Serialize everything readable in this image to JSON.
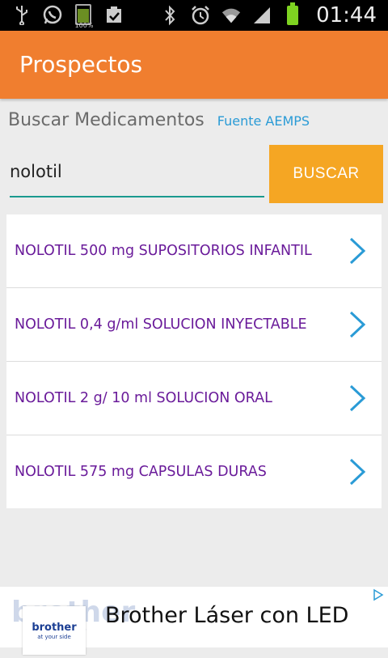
{
  "status_bar": {
    "time": "01:44",
    "small_battery_label": "100%",
    "icons": [
      "usb-icon",
      "whatsapp-icon",
      "battery-full-icon",
      "clipboard-check-icon",
      "bluetooth-icon",
      "alarm-icon",
      "wifi-icon",
      "signal-icon",
      "battery-charging-icon"
    ]
  },
  "app_bar": {
    "title": "Prospectos"
  },
  "search": {
    "heading": "Buscar Medicamentos",
    "source_link": "Fuente AEMPS",
    "query": "nolotil",
    "button_label": "BUSCAR"
  },
  "results": [
    {
      "name": "NOLOTIL  500 mg SUPOSITORIOS INFANTIL"
    },
    {
      "name": "NOLOTIL 0,4 g/ml SOLUCION INYECTABLE"
    },
    {
      "name": "NOLOTIL 2 g/ 10 ml SOLUCION ORAL"
    },
    {
      "name": "NOLOTIL 575 mg CAPSULAS DURAS"
    }
  ],
  "ad": {
    "logo_brand": "brother",
    "logo_tagline": "at your side",
    "text": "Brother Láser con LED"
  },
  "colors": {
    "app_bar": "#f07e2f",
    "button": "#f5a623",
    "link": "#2a9bd6",
    "result_text": "#6a1b9a",
    "chevron": "#2a9bd6",
    "input_underline": "#1a9a8f"
  }
}
